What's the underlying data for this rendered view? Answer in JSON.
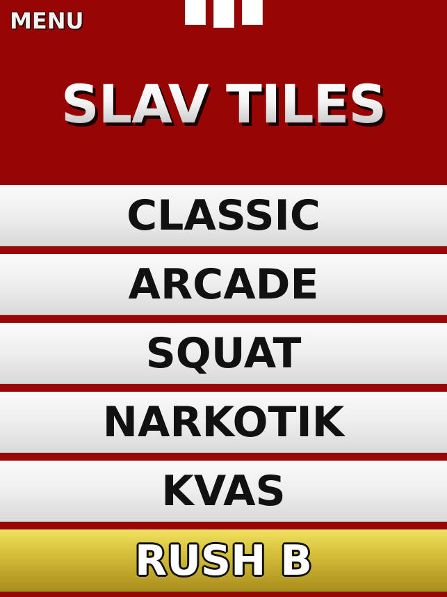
{
  "header": {
    "menu_label": "MENU",
    "title": "SLAV TILES",
    "pause_icon": "pause-icon"
  },
  "tiles": [
    {
      "label": "CLASSIC",
      "style": "silver"
    },
    {
      "label": "ARCADE",
      "style": "silver"
    },
    {
      "label": "SQUAT",
      "style": "silver"
    },
    {
      "label": "NARKOTIK",
      "style": "silver"
    },
    {
      "label": "KVAS",
      "style": "silver"
    },
    {
      "label": "RUSH B",
      "style": "gold"
    }
  ],
  "colors": {
    "background_red": "#9a0606",
    "tile_silver": "#eeeeee",
    "tile_gold": "#d8c23c",
    "text_dark": "#111111",
    "text_light": "#f4f4f4"
  }
}
